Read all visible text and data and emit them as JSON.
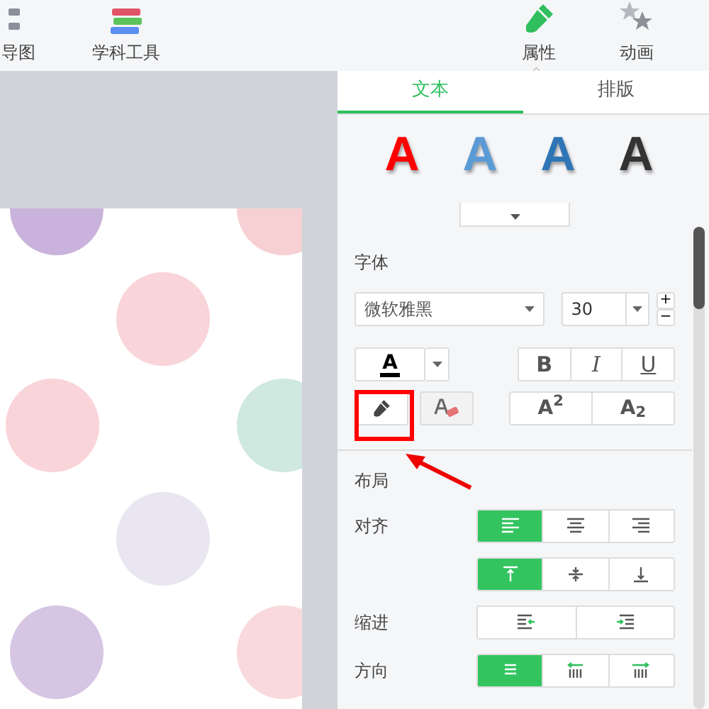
{
  "toolbar": [
    {
      "label": "导图",
      "selected": false
    },
    {
      "label": "学科工具",
      "selected": false
    },
    {
      "label": "属性",
      "selected": true
    },
    {
      "label": "动画",
      "selected": false
    }
  ],
  "panel": {
    "tabs": [
      {
        "label": "文本",
        "selected": true
      },
      {
        "label": "排版",
        "selected": false
      }
    ],
    "text_styles": [
      {
        "label": "A",
        "color": "#ff0000"
      },
      {
        "label": "A",
        "color": "#5b9bd5"
      },
      {
        "label": "A",
        "color": "#2e75b6"
      },
      {
        "label": "A",
        "color": "#333333"
      }
    ],
    "font_section": {
      "title": "字体",
      "font": "微软雅黑",
      "size": "30",
      "size_up": "+",
      "size_down": "−",
      "color_button": "A",
      "bold": "B",
      "italic": "I",
      "underline": "U",
      "superscript": "A$^{2}$",
      "subscript": "A$_{2}$"
    },
    "layout_section": {
      "title": "布局",
      "align_label": "对齐",
      "horizontal_align": [
        {
          "selected": true
        },
        {
          "selected": false
        },
        {
          "selected": false
        }
      ],
      "vertical_align": [
        {
          "selected": true
        },
        {
          "selected": false
        },
        {
          "selected": false
        }
      ],
      "indent_label": "缩进",
      "indent": [
        {
          "selected": false
        },
        {
          "selected": false
        }
      ],
      "direction_label": "方向",
      "direction": [
        {
          "selected": true
        },
        {
          "selected": false
        },
        {
          "selected": false
        }
      ]
    }
  }
}
